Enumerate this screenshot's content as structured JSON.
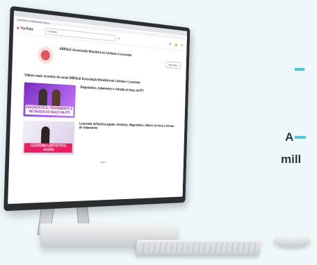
{
  "side": {
    "letter": "A",
    "word": "mill"
  },
  "browser": {
    "url": "youtube.com/@abrale/videos"
  },
  "youtube": {
    "search_value": "Ici abrale",
    "logo": "YouTube"
  },
  "channel": {
    "name": "ABRALE Associação Brasileira de Linfoma e Leucemia",
    "subscribe_label": "INSCRITO"
  },
  "section_title": "Vídeos mais recentes do canal ABRALE Associação Brasileira de Linfoma e Leucemia",
  "videos": [
    {
      "title": "Diagnóstico, tratamento e retirada do baço na PTI",
      "thumb_caption": "DIAGNÓSTICO, TRATAMENTO E RETIRADA DO BAÇO NA PTI"
    },
    {
      "title": "Leucemia linfocítica aguda: sintomas, diagnóstico, fatores de risco e formas de tratamento",
      "thumb_caption": "LEUCEMIA LINFOCÍTICA AGUDA"
    }
  ],
  "more_label": "MAIS",
  "colors": {
    "accent": "#4fc3d9",
    "youtube_red": "#e53935",
    "thumb_purple": "#7b2cbf",
    "thumb_pink": "#e91e63"
  }
}
